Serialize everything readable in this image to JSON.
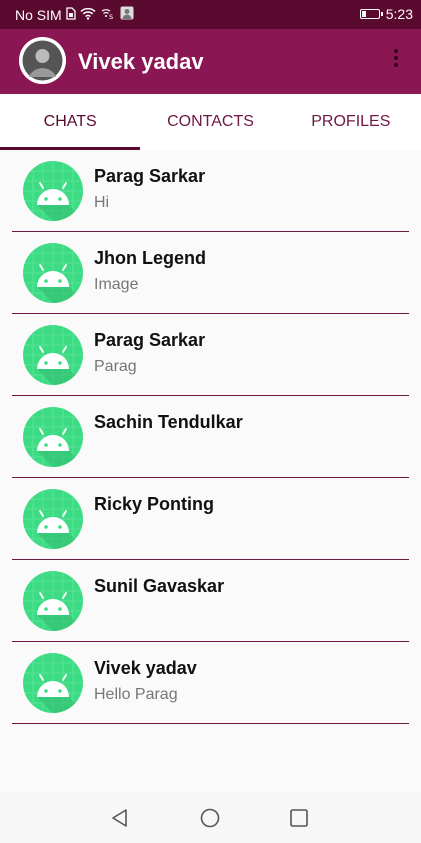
{
  "status_bar": {
    "carrier": "No SIM",
    "time": "5:23",
    "icons": [
      "sim-card-icon",
      "wifi-icon",
      "data-signal-icon",
      "app-notification-icon",
      "battery-icon"
    ]
  },
  "app_bar": {
    "title": "Vivek yadav",
    "avatar_icon": "user-avatar-icon",
    "menu_icon": "more-vert-icon",
    "color": "#8b1654"
  },
  "tabs": [
    {
      "label": "CHATS",
      "active": true
    },
    {
      "label": "CONTACTS",
      "active": false
    },
    {
      "label": "PROFILES",
      "active": false
    }
  ],
  "chats": [
    {
      "name": "Parag Sarkar",
      "message": "Hi"
    },
    {
      "name": "Jhon Legend",
      "message": "Image"
    },
    {
      "name": "Parag Sarkar",
      "message": "Parag"
    },
    {
      "name": "Sachin Tendulkar",
      "message": ""
    },
    {
      "name": "Ricky Ponting",
      "message": ""
    },
    {
      "name": "Sunil Gavaskar",
      "message": ""
    },
    {
      "name": "Vivek yadav",
      "message": "Hello Parag"
    }
  ],
  "nav_bar": {
    "icons": [
      "back-icon",
      "home-icon",
      "recent-apps-icon"
    ]
  },
  "colors": {
    "status_bar": "#5a0a2f",
    "accent": "#8b1654",
    "divider": "#6a1741",
    "android_green": "#3ddc84"
  }
}
